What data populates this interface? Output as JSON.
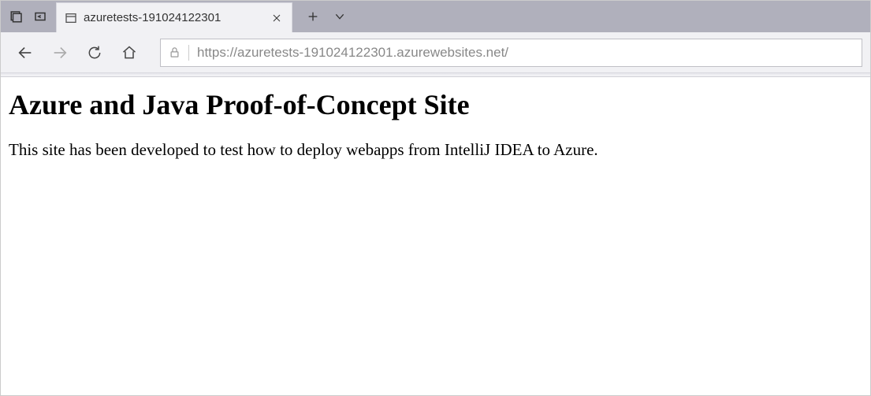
{
  "tab": {
    "title": "azuretests-191024122301"
  },
  "address": {
    "url": "https://azuretests-191024122301.azurewebsites.net/"
  },
  "page": {
    "heading": "Azure and Java Proof-of-Concept Site",
    "body": "This site has been developed to test how to deploy webapps from IntelliJ IDEA to Azure."
  }
}
